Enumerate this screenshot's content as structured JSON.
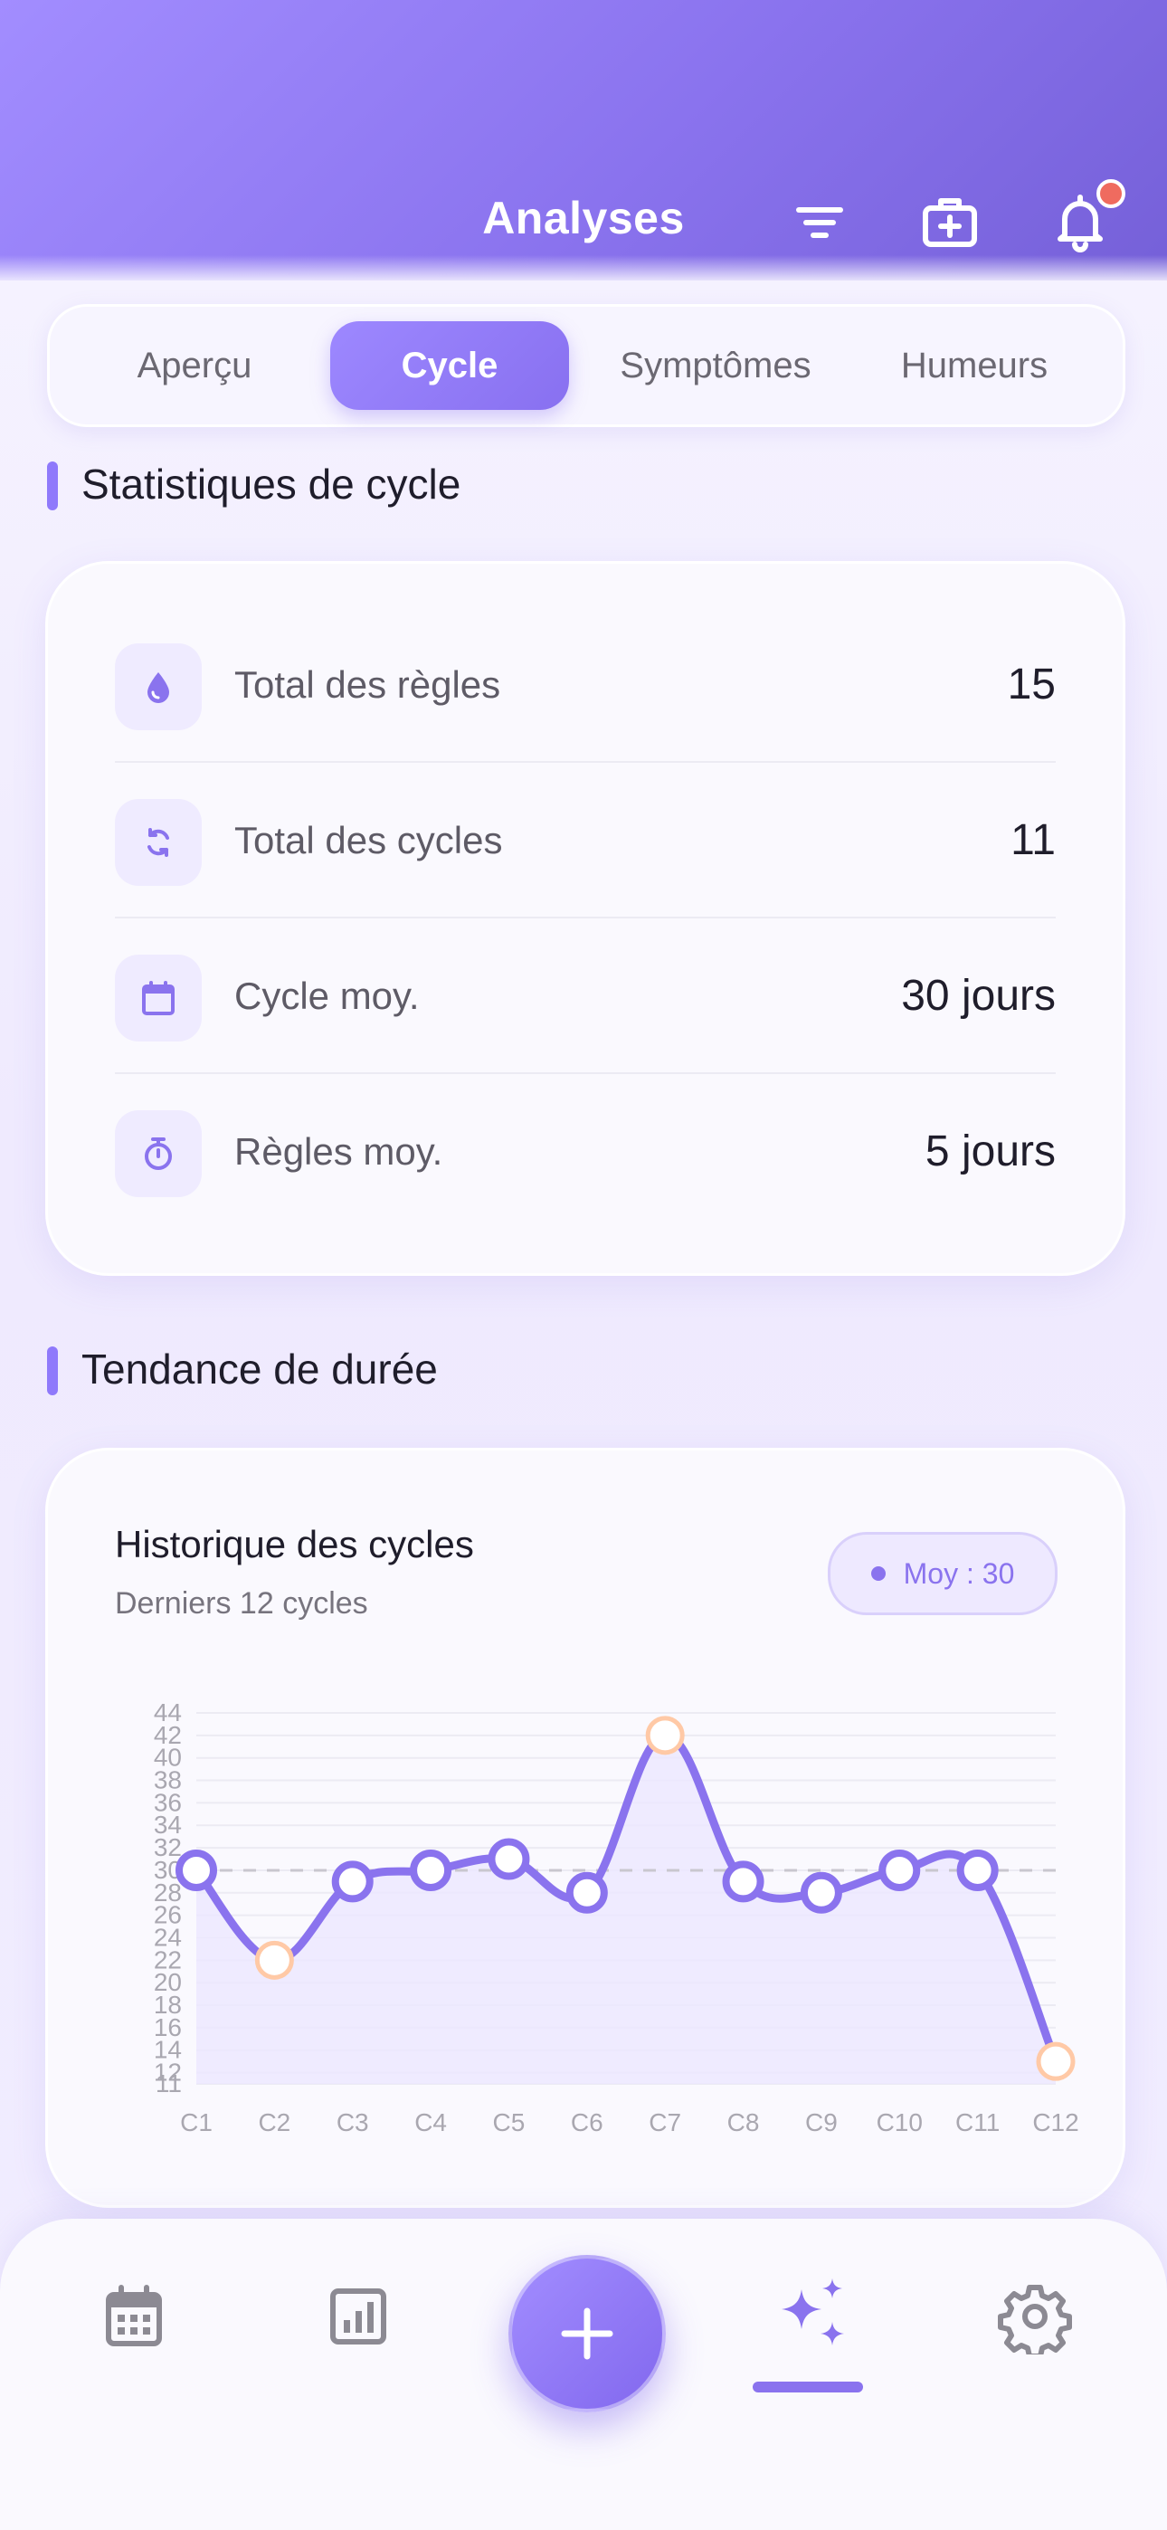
{
  "header": {
    "title": "Analyses",
    "icons": [
      "filter-icon",
      "medical-kit-icon",
      "bell-icon"
    ]
  },
  "tabs": [
    {
      "label": "Aperçu",
      "active": false
    },
    {
      "label": "Cycle",
      "active": true
    },
    {
      "label": "Symptômes",
      "active": false
    },
    {
      "label": "Humeurs",
      "active": false
    }
  ],
  "stats_section": {
    "title": "Statistiques de cycle",
    "items": [
      {
        "icon": "drop-icon",
        "label": "Total des règles",
        "value": "15"
      },
      {
        "icon": "refresh-icon",
        "label": "Total des cycles",
        "value": "11"
      },
      {
        "icon": "calendar-icon",
        "label": "Cycle moy.",
        "value": "30 jours"
      },
      {
        "icon": "timer-icon",
        "label": "Règles moy.",
        "value": "5 jours"
      }
    ]
  },
  "trend_section": {
    "title": "Tendance de durée",
    "card_title": "Historique des cycles",
    "card_subtitle": "Derniers 12 cycles",
    "average_pill": "Moy : 30"
  },
  "chart_data": {
    "type": "line",
    "title": "Historique des cycles",
    "x": [
      "C1",
      "C2",
      "C3",
      "C4",
      "C5",
      "C6",
      "C7",
      "C8",
      "C9",
      "C10",
      "C11",
      "C12"
    ],
    "series": [
      {
        "values": [
          30,
          22,
          29,
          30,
          31,
          28,
          42,
          29,
          28,
          30,
          30,
          13
        ]
      }
    ],
    "highlighted_points": [
      "C2",
      "C7",
      "C12"
    ],
    "reference_line": {
      "value": 30
    },
    "y_ticks": [
      11,
      12,
      14,
      16,
      18,
      20,
      22,
      24,
      26,
      28,
      30,
      32,
      34,
      36,
      38,
      40,
      42,
      44
    ],
    "ylim": [
      11,
      44
    ],
    "grid": true,
    "colors": {
      "line": "#8a73ee",
      "highlight": "#ffc9a6",
      "area": "#ece7ff",
      "reference": "#c9c7cf"
    }
  },
  "bottom_nav": {
    "items": [
      "calendar-icon",
      "bar-chart-icon",
      "add-icon",
      "sparkles-icon",
      "gear-icon"
    ],
    "active": "sparkles-icon"
  },
  "colors": {
    "accent": "#8a73ee",
    "header_gradient_start": "#a28dff",
    "header_gradient_end": "#7560d8",
    "notification": "#ef6b5f"
  }
}
